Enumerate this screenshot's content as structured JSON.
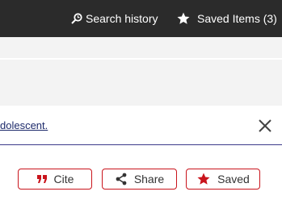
{
  "topbar": {
    "search_history": "Search history",
    "saved_items": "Saved Items (3)"
  },
  "notice": {
    "text": "dolescent."
  },
  "actions": {
    "cite": "Cite",
    "share": "Share",
    "saved": "Saved"
  },
  "colors": {
    "topbar_bg": "#2b2b2b",
    "accent_red": "#c9141c",
    "notice_border": "#3c3a8a"
  },
  "icons": {
    "search_history": "search-history-icon",
    "saved_items": "star-icon",
    "close": "close-icon",
    "cite": "quote-icon",
    "share": "share-icon",
    "saved": "star-icon"
  }
}
